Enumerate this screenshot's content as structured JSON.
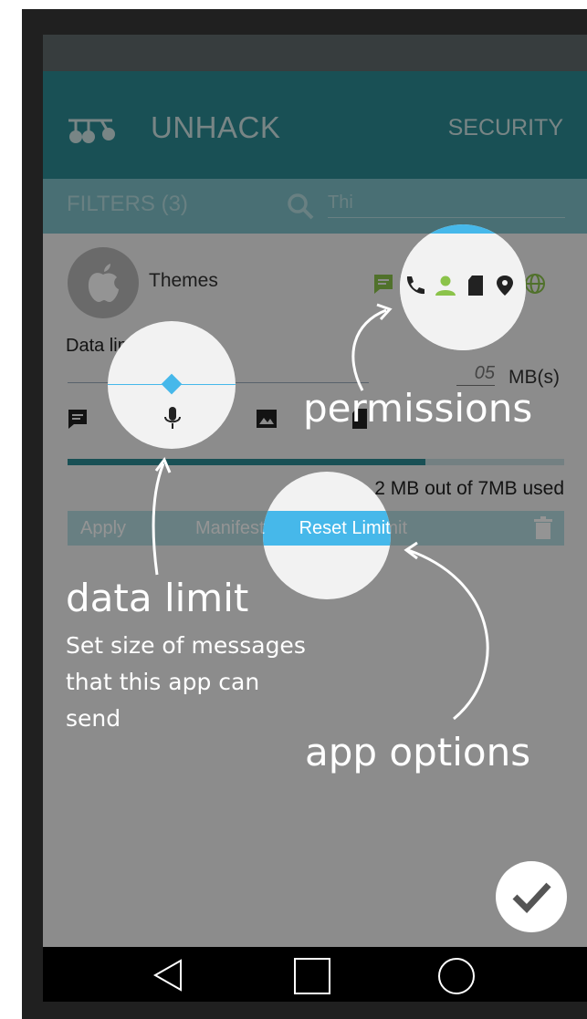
{
  "app": {
    "title": "UNHACK",
    "tab": "SECURITY"
  },
  "filters": {
    "label": "FILTERS (3)",
    "search_value": "Thi"
  },
  "app_card": {
    "name": "Themes",
    "data_limit_label": "Data limit",
    "limit_placeholder": "05",
    "limit_unit": "MB(s)",
    "usage_fraction": 0.72,
    "usage_text": "2 MB out of 7MB used",
    "permissions": [
      "message-icon",
      "phone-icon",
      "contact-icon",
      "sd-card-icon",
      "location-icon",
      "globe-icon"
    ]
  },
  "options": {
    "apply": "Apply",
    "manifest": "Manifest",
    "reset": "Reset Limit"
  },
  "tutorial": {
    "permissions": "permissions",
    "data_limit": "data limit",
    "data_limit_desc_1": "Set size of messages",
    "data_limit_desc_2": "that this app can",
    "data_limit_desc_3": "send",
    "app_options": "app options"
  },
  "colors": {
    "primary": "#2b8a93",
    "accent": "#46b8ea",
    "green": "#8bc34a"
  }
}
